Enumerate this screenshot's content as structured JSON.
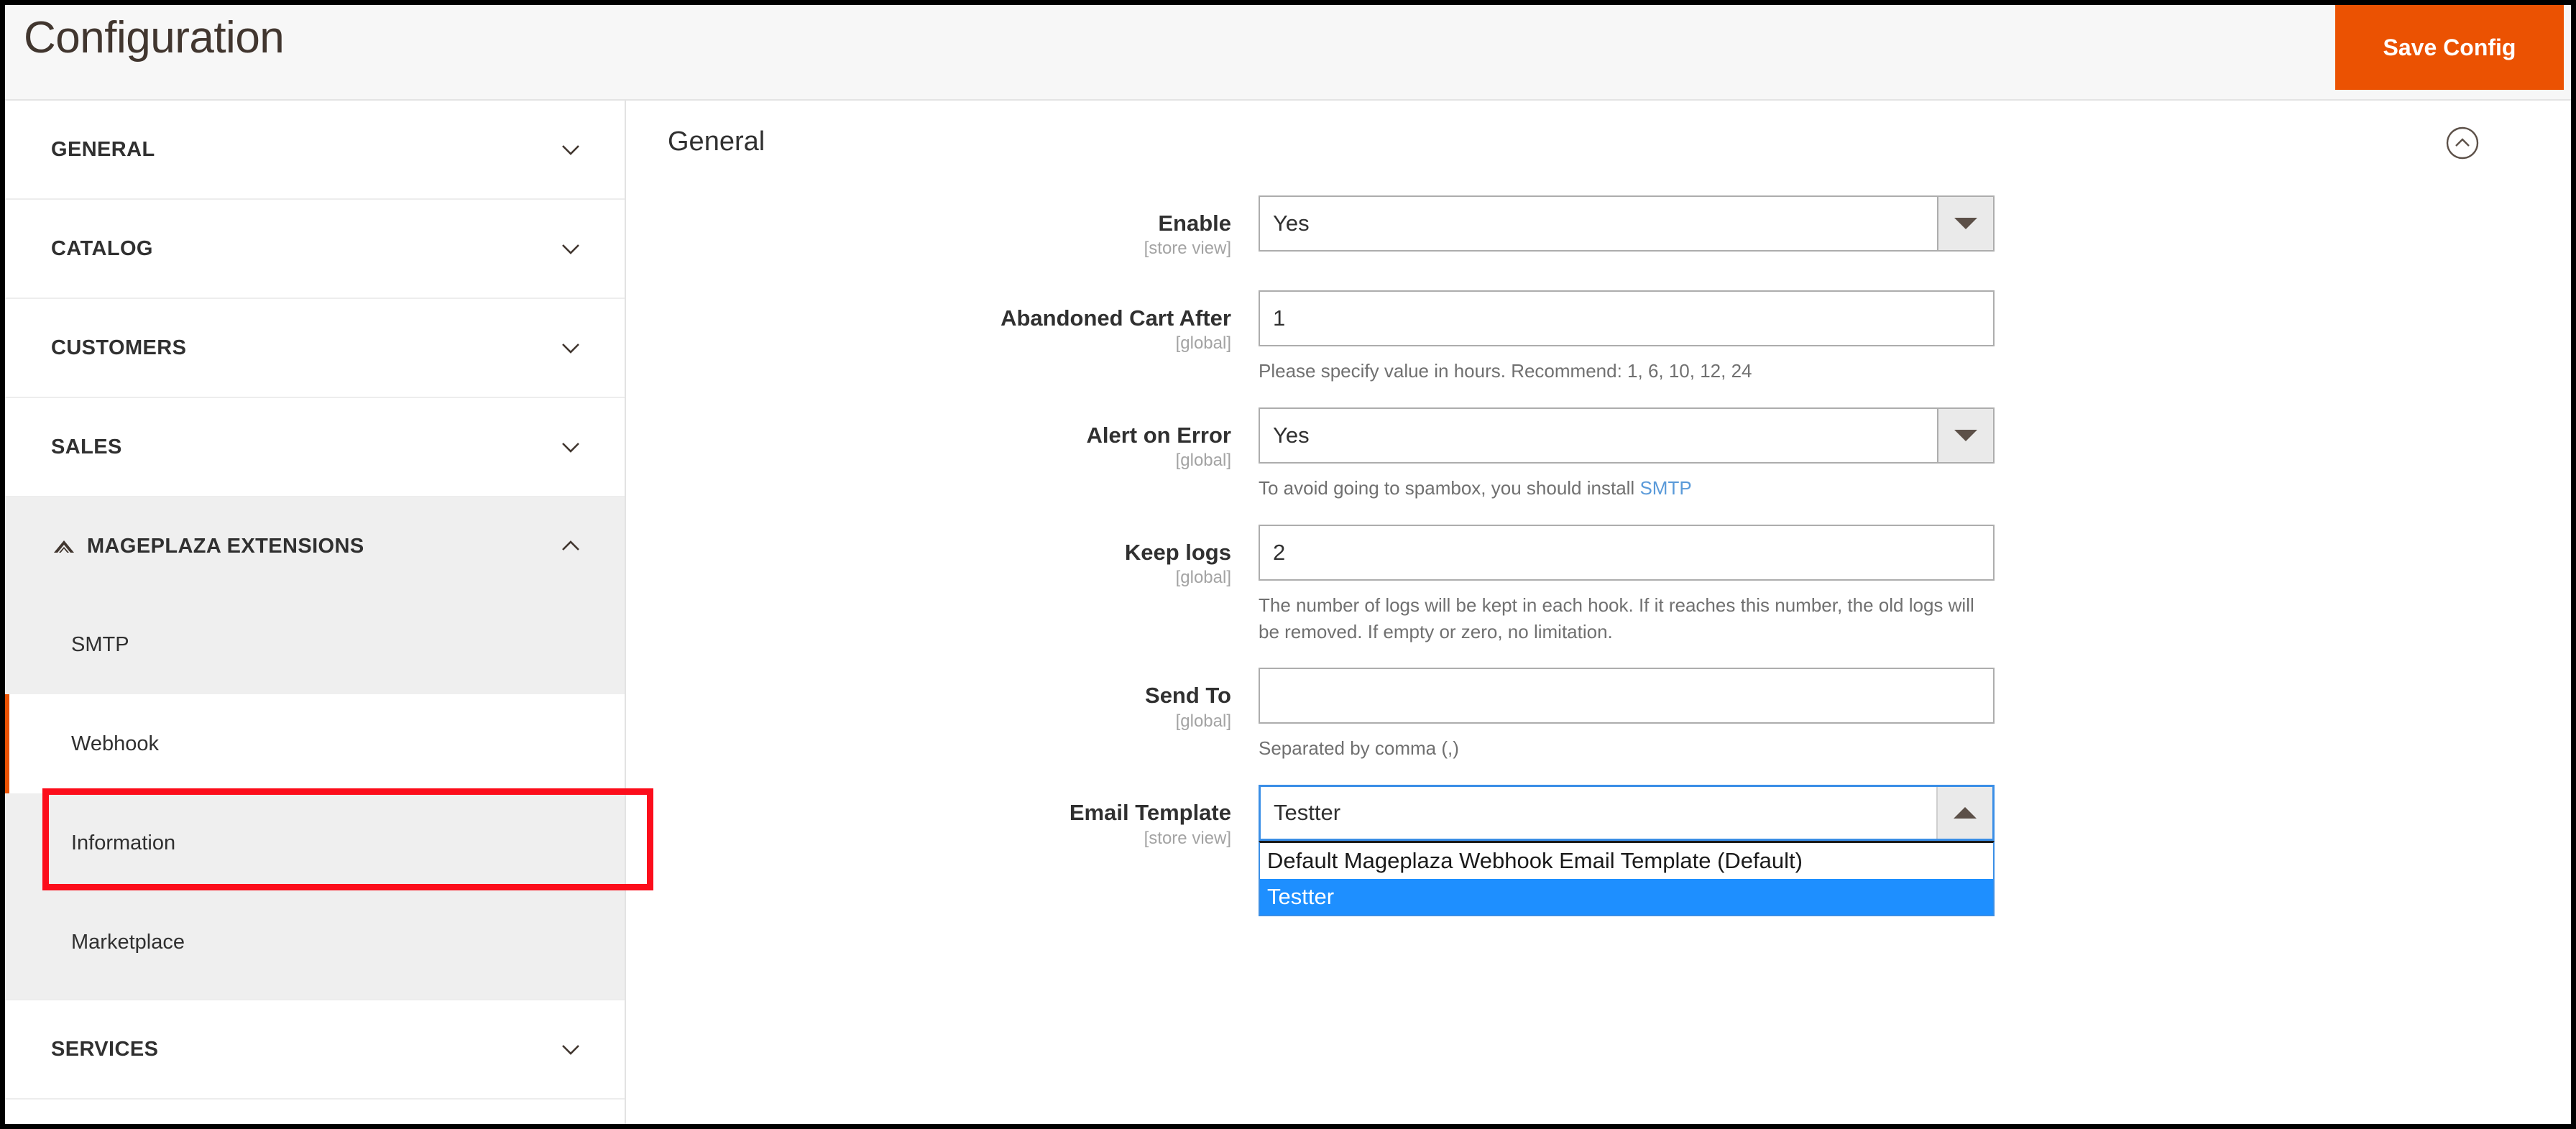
{
  "header": {
    "title": "Configuration",
    "save_label": "Save Config",
    "accent_color": "#eb5202"
  },
  "sidebar": {
    "sections": [
      {
        "label": "GENERAL",
        "expanded": false,
        "icon": "chevron-down-icon"
      },
      {
        "label": "CATALOG",
        "expanded": false,
        "icon": "chevron-down-icon"
      },
      {
        "label": "CUSTOMERS",
        "expanded": false,
        "icon": "chevron-down-icon"
      },
      {
        "label": "SALES",
        "expanded": false,
        "icon": "chevron-down-icon"
      },
      {
        "label": "MAGEPLAZA EXTENSIONS",
        "expanded": true,
        "icon": "chevron-up-icon",
        "logo": "mageplaza-logo-icon"
      },
      {
        "label": "SERVICES",
        "expanded": false,
        "icon": "chevron-down-icon"
      }
    ],
    "mageplaza_children": [
      {
        "label": "SMTP",
        "active": false
      },
      {
        "label": "Webhook",
        "active": true,
        "annotated": true
      },
      {
        "label": "Information",
        "active": false
      },
      {
        "label": "Marketplace",
        "active": false
      }
    ],
    "annotation_color": "#fc0d1b",
    "active_accent_color": "#eb5202"
  },
  "main": {
    "section_title": "General",
    "collapse_icon": "chevron-up-circle-icon",
    "fields": [
      {
        "label": "Enable",
        "scope": "[store view]",
        "type": "select",
        "value": "Yes",
        "hint": "",
        "open": false
      },
      {
        "label": "Abandoned Cart After",
        "scope": "[global]",
        "type": "text",
        "value": "1",
        "hint": "Please specify value in hours. Recommend: 1, 6, 10, 12, 24",
        "open": false
      },
      {
        "label": "Alert on Error",
        "scope": "[global]",
        "type": "select",
        "value": "Yes",
        "hint_prefix": "To avoid going to spambox, you should install ",
        "hint_link": "SMTP",
        "open": false
      },
      {
        "label": "Keep logs",
        "scope": "[global]",
        "type": "text",
        "value": "2",
        "hint": "The number of logs will be kept in each hook. If it reaches this number, the old logs will be removed. If empty or zero, no limitation.",
        "open": false
      },
      {
        "label": "Send To",
        "scope": "[global]",
        "type": "text",
        "value": "",
        "placeholder": "",
        "hint": "Separated by comma (,)",
        "open": false
      },
      {
        "label": "Email Template",
        "scope": "[store view]",
        "type": "select",
        "value": "Testter",
        "hint": "",
        "open": true,
        "options": [
          {
            "label": "Default Mageplaza Webhook Email Template (Default)",
            "selected": false
          },
          {
            "label": "Testter",
            "selected": true
          }
        ],
        "highlight_color": "#1e8fff"
      }
    ]
  }
}
